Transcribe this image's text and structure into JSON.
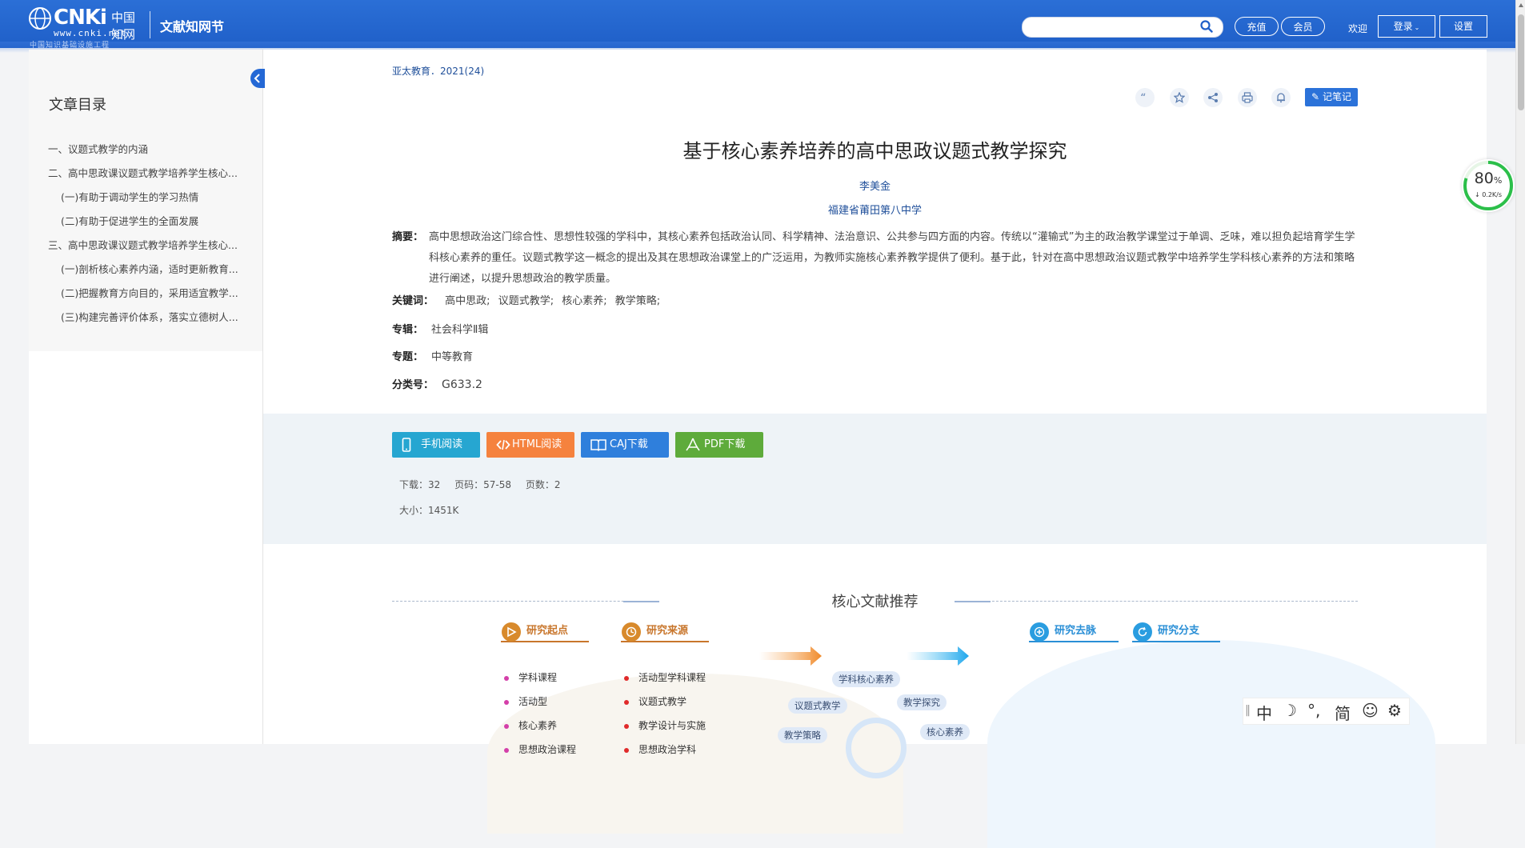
{
  "header": {
    "logo": {
      "main": "CNKi",
      "cn": "中国知网",
      "url": "www.cnki.net",
      "sub": "中国知识基础设施工程"
    },
    "site_name": "文献知网节",
    "search_placeholder": "",
    "recharge": "充值",
    "member": "会员",
    "welcome": "欢迎",
    "login": "登录",
    "settings": "设置"
  },
  "toc": {
    "title": "文章目录",
    "items": [
      {
        "label": "一、议题式教学的内涵",
        "level": 1
      },
      {
        "label": "二、高中思政课议题式教学培养学生核心...",
        "level": 1
      },
      {
        "label": "(一)有助于调动学生的学习热情",
        "level": 2
      },
      {
        "label": "(二)有助于促进学生的全面发展",
        "level": 2
      },
      {
        "label": "三、高中思政课议题式教学培养学生核心...",
        "level": 1
      },
      {
        "label": "(一)剖析核心素养内涵，适时更新教育...",
        "level": 2
      },
      {
        "label": "(二)把握教育方向目的，采用适宜教学...",
        "level": 2
      },
      {
        "label": "(三)构建完善评价体系，落实立德树人...",
        "level": 2
      }
    ]
  },
  "article": {
    "journal": "亚太教育．2021(24)",
    "note_button": "记笔记",
    "title": "基于核心素养培养的高中思政议题式教学探究",
    "author": "李美金",
    "affiliation": "福建省莆田第八中学",
    "abstract_label": "摘要：",
    "abstract": "高中思想政治这门综合性、思想性较强的学科中，其核心素养包括政治认同、科学精神、法治意识、公共参与四方面的内容。传统以“灌输式”为主的政治教学课堂过于单调、乏味，难以担负起培育学生学科核心素养的重任。议题式教学这一概念的提出及其在思想政治课堂上的广泛运用，为教师实施核心素养教学提供了便利。基于此，针对在高中思想政治议题式教学中培养学生学科核心素养的方法和策略进行阐述，以提升思想政治的教学质量。",
    "keywords_label": "关键词：",
    "keywords": [
      "高中思政;",
      "议题式教学;",
      "核心素养;",
      "教学策略;"
    ],
    "series_label": "专辑：",
    "series": "社会科学Ⅱ辑",
    "topic_label": "专题：",
    "topic": "中等教育",
    "class_label": "分类号：",
    "class_no": "G633.2"
  },
  "downloads": {
    "mobile": "手机阅读",
    "html": "HTML阅读",
    "caj": "CAJ下载",
    "pdf": "PDF下载",
    "downloads_count": "下载：32",
    "pages_range": "页码：57-58",
    "page_count": "页数：2",
    "size": "大小：1451K"
  },
  "recommend": {
    "title": "核心文献推荐",
    "start_head": "研究起点",
    "source_head": "研究来源",
    "trend_head": "研究去脉",
    "branch_head": "研究分支",
    "start_items": [
      "学科课程",
      "活动型",
      "核心素养",
      "思想政治课程"
    ],
    "source_items": [
      "活动型学科课程",
      "议题式教学",
      "教学设计与实施",
      "思想政治学科"
    ],
    "nodes": [
      "学科核心素养",
      "议题式教学",
      "教学探究",
      "教学策略",
      "核心素养"
    ]
  },
  "speed_widget": {
    "percent": "80",
    "percent_unit": "%",
    "rate": "↓ 0.2K/s",
    "fill_fraction": 0.8
  },
  "ime": {
    "chinese": "中",
    "moon": "☽",
    "punct": "°,",
    "simplified": "简",
    "smile": "☺",
    "gear": "⚙"
  },
  "colors": {
    "header": "#1f5fc8",
    "link": "#1f4f9a",
    "mobile": "#26a6d1",
    "html": "#f5823e",
    "caj": "#2f7fdc",
    "pdf": "#5eab3b"
  }
}
